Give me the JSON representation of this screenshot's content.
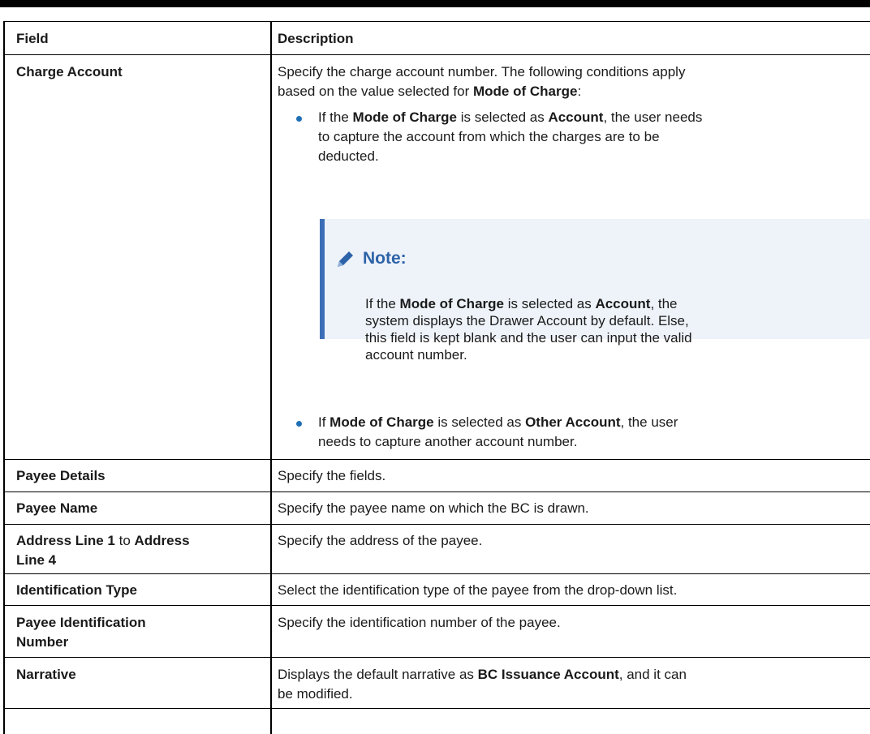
{
  "header": {
    "field": "Field",
    "description": "Description"
  },
  "rows": [
    {
      "field": "Charge Account",
      "desc_line1": "Specify the charge account number. The following conditions apply",
      "desc_line2_a": "based on the value selected for ",
      "desc_line2_b": "Mode of Charge",
      "desc_line2_c": ":",
      "bullet1_a": "If the ",
      "bullet1_b": "Mode of Charge",
      "bullet1_c": " is selected as ",
      "bullet1_d": "Account",
      "bullet1_e": ", the user needs",
      "bullet1_line2": "to capture the account from which the charges are to be",
      "bullet1_line3": "deducted.",
      "note_title": "Note:",
      "note_a": "If the ",
      "note_b": "Mode of Charge",
      "note_c": " is selected as ",
      "note_d": "Account",
      "note_e": ", the",
      "note_line2": "system displays the Drawer Account by default. Else,",
      "note_line3": "this field is kept blank and the user can input the valid",
      "note_line4": "account number.",
      "bullet2_a": "If ",
      "bullet2_b": "Mode of Charge",
      "bullet2_c": " is selected as ",
      "bullet2_d": "Other Account",
      "bullet2_e": ", the user",
      "bullet2_line2": "needs to capture another account number."
    },
    {
      "field": "Payee Details",
      "desc": "Specify the fields."
    },
    {
      "field": "Payee Name",
      "desc": "Specify the payee name on which the BC is drawn."
    },
    {
      "field_a": "Address Line 1",
      "field_b": " to ",
      "field_c": "Address",
      "field_line2": "Line 4",
      "desc": "Specify the address of the payee."
    },
    {
      "field": "Identification Type",
      "desc": "Select the identification type of the payee from the drop-down list."
    },
    {
      "field_line1": "Payee Identification",
      "field_line2": "Number",
      "desc": "Specify the identification number of the payee."
    },
    {
      "field": "Narrative",
      "desc_a": "Displays the default narrative as ",
      "desc_b": "BC Issuance Account",
      "desc_c": ", and it can",
      "desc_line2": "be modified."
    }
  ]
}
